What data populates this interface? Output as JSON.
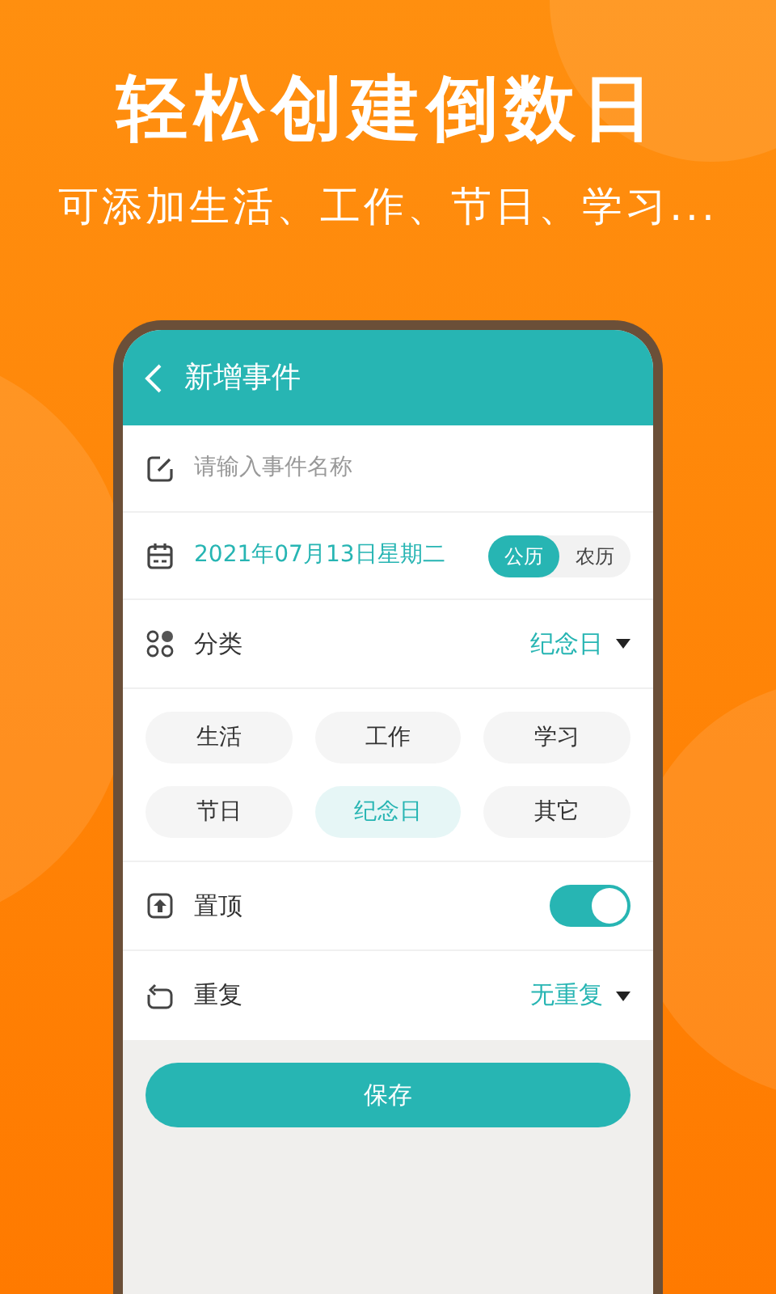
{
  "headline": "轻松创建倒数日",
  "subtitle": "可添加生活、工作、节日、学习...",
  "screen": {
    "title": "新增事件",
    "name_field": {
      "placeholder": "请输入事件名称"
    },
    "date": {
      "value": "2021年07月13日星期二",
      "calendars": [
        {
          "label": "公历",
          "selected": true
        },
        {
          "label": "农历",
          "selected": false
        }
      ]
    },
    "category": {
      "label": "分类",
      "value": "纪念日"
    },
    "category_options": [
      {
        "label": "生活",
        "selected": false
      },
      {
        "label": "工作",
        "selected": false
      },
      {
        "label": "学习",
        "selected": false
      },
      {
        "label": "节日",
        "selected": false
      },
      {
        "label": "纪念日",
        "selected": true
      },
      {
        "label": "其它",
        "selected": false
      }
    ],
    "pin": {
      "label": "置顶",
      "on": true
    },
    "repeat": {
      "label": "重复",
      "value": "无重复"
    },
    "save_button": "保存"
  }
}
